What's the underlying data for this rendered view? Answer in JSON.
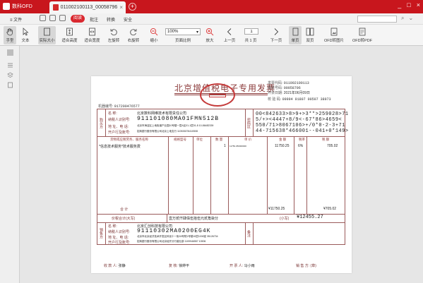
{
  "app": {
    "name": "数科OFD",
    "tab_title": "011002100113_00058796",
    "tab_close": "×",
    "tab_add": "+",
    "window_controls": [
      "_",
      "□",
      "×"
    ]
  },
  "menu": {
    "file": "≡ 文件",
    "home": "阅读",
    "annotate": "批注",
    "convert": "转换",
    "security": "安全"
  },
  "search": {
    "placeholder": ""
  },
  "toolbar": {
    "hand": "手型",
    "text": "文本",
    "actual_size": "实际大小",
    "fit_height": "适合高度",
    "fit_width": "适合宽度",
    "rotate_left": "左旋转",
    "rotate_right": "右旋转",
    "zoom_out": "缩小",
    "zoom_value": "100%",
    "page_ratio": "页面比例",
    "zoom_in": "放大",
    "prev": "上一页",
    "page_current": "1",
    "page_total": "共 1 页",
    "next": "下一页",
    "single": "单页",
    "double": "双页",
    "ofd_to_image": "OFD转图片",
    "ofd_to_pdf": "OFD转PDF"
  },
  "invoice": {
    "title": "北京增值税电子专用发票",
    "code_label": "发票代码:",
    "code": "011002100113",
    "number_label": "发票号码:",
    "number": "00058796",
    "date_label": "开票日期:",
    "date": "2021年06月09日",
    "check_label": "校 验 码:",
    "check": "09994 01807 00507 38973",
    "machine_label": "机器编号:",
    "machine": "917200476577",
    "buyer": {
      "section": "购买方",
      "name_label": "名    称:",
      "name": "北京数科网维技术有限责任公司",
      "tax_label": "纳税人识别号:",
      "tax_id": "911101080MA01FMN512B",
      "addr_label": "地 址、电 话:",
      "addr": "北京市海淀区上地街道产业园10号楼一层A区01-1层01-8 10-86482339",
      "bank_label": "开户行及账号:",
      "bank": "招商银行股份有限公司北京上地支行 110926376410508"
    },
    "cipher_label": "密码区",
    "cipher": [
      "00<842633>8>9+>3**>259028>71",
      "5/+><4447+8/9<-67*86>4659<",
      "550/71>8067106>+/0*0-2-3+71",
      "44-715638*466001--041+0*149>"
    ],
    "columns": [
      "货物或应税劳务、服务名称",
      "规格型号",
      "单位",
      "数 量",
      "单 价",
      "金 额",
      "税率",
      "税 额"
    ],
    "item": {
      "name": "*信息技术服务*技术服务费",
      "qty": "1",
      "price": "11750.250000000",
      "amount": "11750.25",
      "rate": "6%",
      "tax": "705.02"
    },
    "total_label": "合        计",
    "total_amount": "¥11750.25",
    "total_tax": "¥705.02",
    "grand_label": "价税合计(大写)",
    "grand_words": "壹万贰仟肆佰伍拾伍元贰角柒分",
    "grand_small_label": "(小写)",
    "grand_small": "¥12455.27",
    "seller": {
      "section": "销售方",
      "name": "北京汇创科技有限公司",
      "tax_id": "91110302MA0200EG4K",
      "addr": "北京市北京经济技术开发区科创十一街18号院1号楼10层1006室 35126734",
      "bank": "招商银行股份有限公司北京经开分行营业部 1109946557 10906"
    },
    "remark_label": "备注",
    "payee_label": "收 款 人:",
    "payee": "张静",
    "reviewer_label": "复 核:",
    "reviewer": "徐婷平",
    "drawer_label": "开 票 人:",
    "drawer": "马小雨",
    "seller_stamp_label": "销 售 方: (章)"
  },
  "colors": {
    "brand": "#c8161d",
    "invoice_ink": "#8b3a3a",
    "seal": "#c53b3b"
  }
}
